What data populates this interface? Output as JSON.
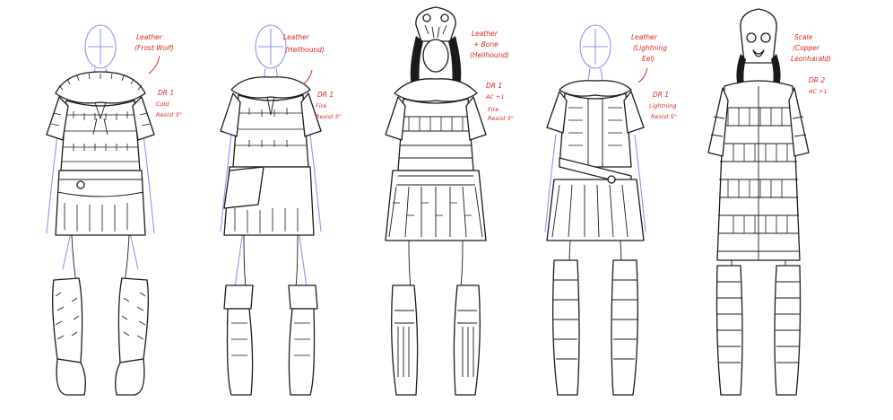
{
  "figures": [
    {
      "id": "frost-wolf",
      "style": "fur",
      "helmet": "none",
      "notes": {
        "material": "Leather",
        "source": "(Frost Wolf)",
        "stat1": "DR 1",
        "stat2": "Cold",
        "stat3": "Resist 5\""
      }
    },
    {
      "id": "hellhound",
      "style": "plain",
      "helmet": "none",
      "notes": {
        "material": "Leather",
        "source": "(Hellhound)",
        "stat1": "DR 1",
        "stat2": "Fire",
        "stat3": "Resist 5\""
      }
    },
    {
      "id": "hellhound-bone",
      "style": "bone",
      "helmet": "skull",
      "notes": {
        "material": "Leather",
        "source": "+ Bone",
        "source2": "(Hellhound)",
        "stat1": "DR 1",
        "stat2": "AC +1",
        "stat3": "Fire",
        "stat4": "Resist 5\""
      }
    },
    {
      "id": "lightning-eel",
      "style": "plain",
      "helmet": "none",
      "notes": {
        "material": "Leather",
        "source": "(Lightning",
        "source2": "Eel)",
        "stat1": "DR 1",
        "stat2": "Lightning",
        "stat3": "Resist 5\""
      }
    },
    {
      "id": "copper-leonharald",
      "style": "scale",
      "helmet": "mask",
      "notes": {
        "material": "Scale",
        "source": "(Copper",
        "source2": "Leonharald)",
        "stat1": "DR 2",
        "stat2": "AC +1"
      }
    }
  ],
  "colors": {
    "guide": "#8e95ee",
    "ink": "#1a1a1a",
    "note": "#d8261c",
    "paper": "#ffffff"
  }
}
